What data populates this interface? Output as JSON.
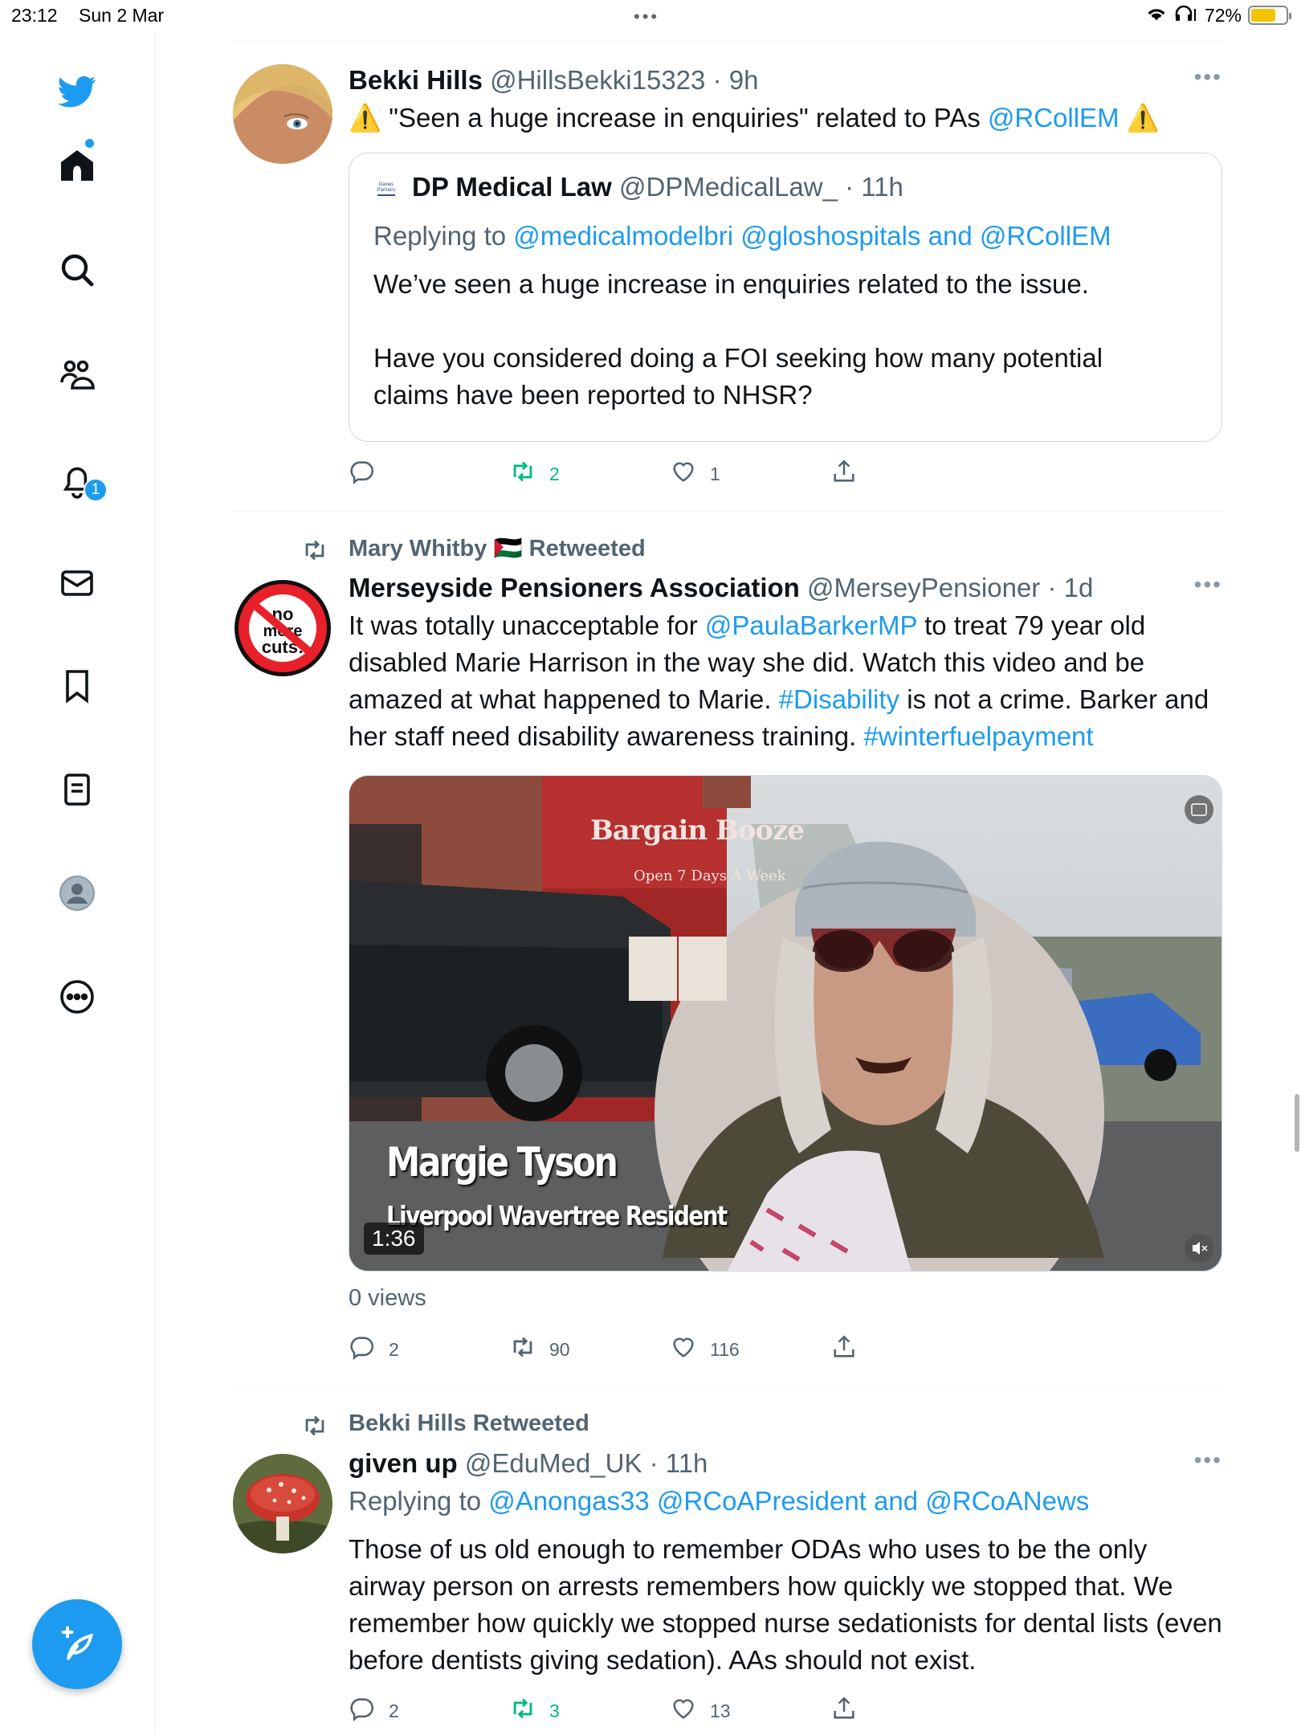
{
  "status_bar": {
    "time": "23:12",
    "date": "Sun 2 Mar",
    "battery": "72%",
    "battery_level": 0.72
  },
  "sidebar": {
    "items": [
      {
        "icon": "twitter-bird-icon"
      },
      {
        "icon": "home-icon"
      },
      {
        "icon": "search-icon"
      },
      {
        "icon": "communities-icon"
      },
      {
        "icon": "notifications-bell-icon",
        "badge": "1"
      },
      {
        "icon": "messages-icon"
      },
      {
        "icon": "bookmarks-icon"
      },
      {
        "icon": "lists-icon"
      },
      {
        "icon": "profile-icon"
      },
      {
        "icon": "more-icon"
      }
    ],
    "compose_icon": "compose-feather-icon"
  },
  "tweets": [
    {
      "name": "Bekki Hills",
      "handle": "@HillsBekki15323",
      "time": "· 9h",
      "text_pre": "⚠️ \"Seen a huge increase in enquiries\" related to PAs ",
      "text_link": "@RCollEM",
      "text_post": " ⚠️",
      "quote": {
        "name": "DP Medical Law",
        "handle": "@DPMedicalLaw_",
        "time": "· 11h",
        "replying_label": "Replying to ",
        "replying_links": "@medicalmodelbri @gloshospitals and @RCollEM",
        "para1": "We’ve seen a huge increase in enquiries related to the issue.",
        "para2": "Have you considered doing a FOI seeking how many potential claims have been reported to NHSR?"
      },
      "replies": "",
      "retweets": "2",
      "likes": "1"
    },
    {
      "retweeted_by": "Mary Whitby 🇵🇸 Retweeted",
      "name": "Merseyside Pensioners Association",
      "handle": "@MerseyPensioner",
      "time": "· 1d",
      "text": {
        "a": "It was totally unacceptable for ",
        "b": "@PaulaBarkerMP",
        "c": " to treat 79 year old disabled Marie Harrison in the way she did. Watch this video and be amazed at what happened to Marie. ",
        "d": "#Disability",
        "e": " is not a crime. Barker and her staff need disability awareness training. ",
        "f": "#winterfuelpayment"
      },
      "video": {
        "shop_sign": "Bargain Booze",
        "shop_sub": "Open 7 Days A Week",
        "caption_name": "Margie Tyson",
        "caption_sub": "Liverpool Wavertree Resident",
        "duration": "1:36"
      },
      "views": "0 views",
      "replies": "2",
      "retweets": "90",
      "likes": "116"
    },
    {
      "retweeted_by": "Bekki Hills Retweeted",
      "name": "given up",
      "handle": "@EduMed_UK",
      "time": "· 11h",
      "replying_label": "Replying to ",
      "replying_links": "@Anongas33 @RCoAPresident and @RCoANews",
      "text": "Those of us old enough to remember ODAs who uses to be the only airway person on arrests remembers how quickly we stopped that. We remember how quickly we stopped nurse sedationists for dental lists (even before dentists giving sedation). AAs should not exist.",
      "replies": "2",
      "retweets": "3",
      "likes": "13"
    }
  ],
  "colors": {
    "accent": "#1d9bf0",
    "retweet_green": "#00ba7c",
    "secondary_text": "#536471"
  }
}
